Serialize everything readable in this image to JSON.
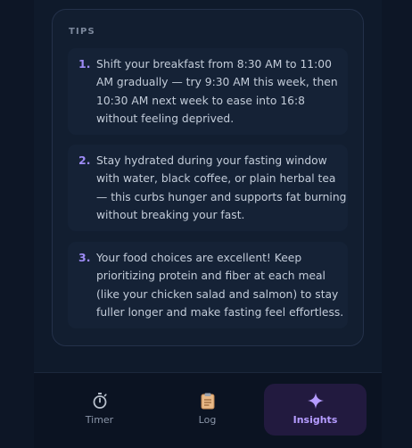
{
  "tips": {
    "heading": "TIPS",
    "items": [
      {
        "number": "1.",
        "text": "Shift your breakfast from 8:30 AM to 11:00 AM gradually — try 9:30 AM this week, then 10:30 AM next week to ease into 16:8 without feeling deprived."
      },
      {
        "number": "2.",
        "text": "Stay hydrated during your fasting window with water, black coffee, or plain herbal tea — this curbs hunger and supports fat burning without breaking your fast."
      },
      {
        "number": "3.",
        "text": "Your food choices are excellent! Keep prioritizing protein and fiber at each meal (like your chicken salad and salmon) to stay fuller longer and make fasting feel effortless."
      }
    ]
  },
  "nav": {
    "items": [
      {
        "label": "Timer",
        "icon": "stopwatch-icon",
        "active": false
      },
      {
        "label": "Log",
        "icon": "clipboard-icon",
        "active": false
      },
      {
        "label": "Insights",
        "icon": "sparkle-icon",
        "active": true
      }
    ]
  },
  "colors": {
    "accent": "#9d8bf5",
    "active_tab_bg": "#221a3f",
    "card_bg": "#121e30"
  }
}
